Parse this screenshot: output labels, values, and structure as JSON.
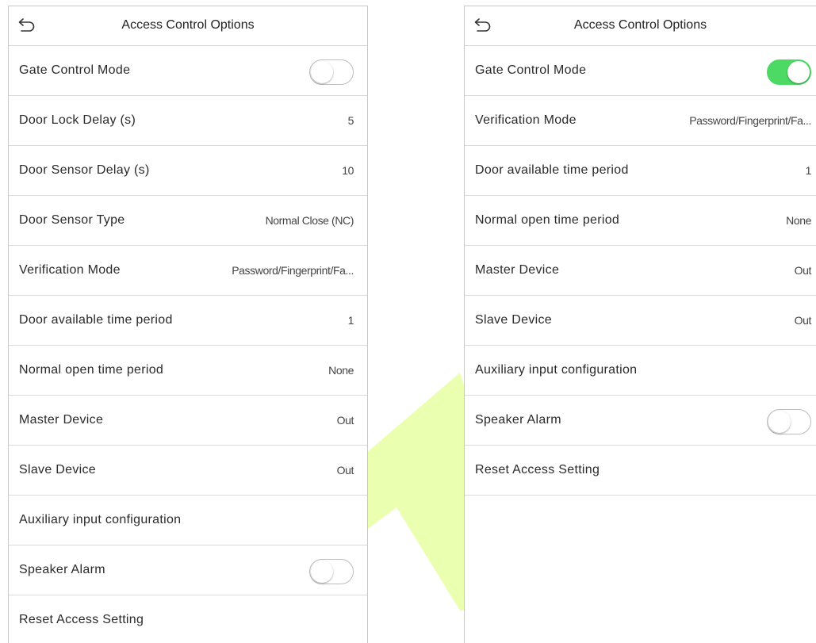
{
  "colors": {
    "toggle_on": "#4cd964",
    "toggle_off_border": "#bdbdbd",
    "watermark": "#eaffb0"
  },
  "left_screen": {
    "title": "Access Control Options",
    "back_icon": "back-arrow-icon",
    "rows": [
      {
        "label": "Gate Control Mode",
        "type": "toggle",
        "on": false
      },
      {
        "label": "Door Lock Delay (s)",
        "value": "5"
      },
      {
        "label": "Door Sensor Delay (s)",
        "value": "10"
      },
      {
        "label": "Door Sensor Type",
        "value": "Normal Close (NC)"
      },
      {
        "label": "Verification Mode",
        "value": "Password/Fingerprint/Fa..."
      },
      {
        "label": "Door available time period",
        "value": "1"
      },
      {
        "label": "Normal open time period",
        "value": "None"
      },
      {
        "label": "Master Device",
        "value": "Out"
      },
      {
        "label": "Slave Device",
        "value": "Out"
      },
      {
        "label": "Auxiliary input configuration",
        "value": ""
      },
      {
        "label": "Speaker Alarm",
        "type": "toggle",
        "on": false
      },
      {
        "label": "Reset Access Setting",
        "value": ""
      }
    ]
  },
  "right_screen": {
    "title": "Access Control Options",
    "back_icon": "back-arrow-icon",
    "rows": [
      {
        "label": "Gate Control Mode",
        "type": "toggle",
        "on": true
      },
      {
        "label": "Verification Mode",
        "value": "Password/Fingerprint/Fa..."
      },
      {
        "label": "Door available time period",
        "value": "1"
      },
      {
        "label": "Normal open time period",
        "value": "None"
      },
      {
        "label": "Master Device",
        "value": "Out"
      },
      {
        "label": "Slave Device",
        "value": "Out"
      },
      {
        "label": "Auxiliary input configuration",
        "value": ""
      },
      {
        "label": "Speaker Alarm",
        "type": "toggle",
        "on": false
      },
      {
        "label": "Reset Access Setting",
        "value": ""
      }
    ]
  }
}
